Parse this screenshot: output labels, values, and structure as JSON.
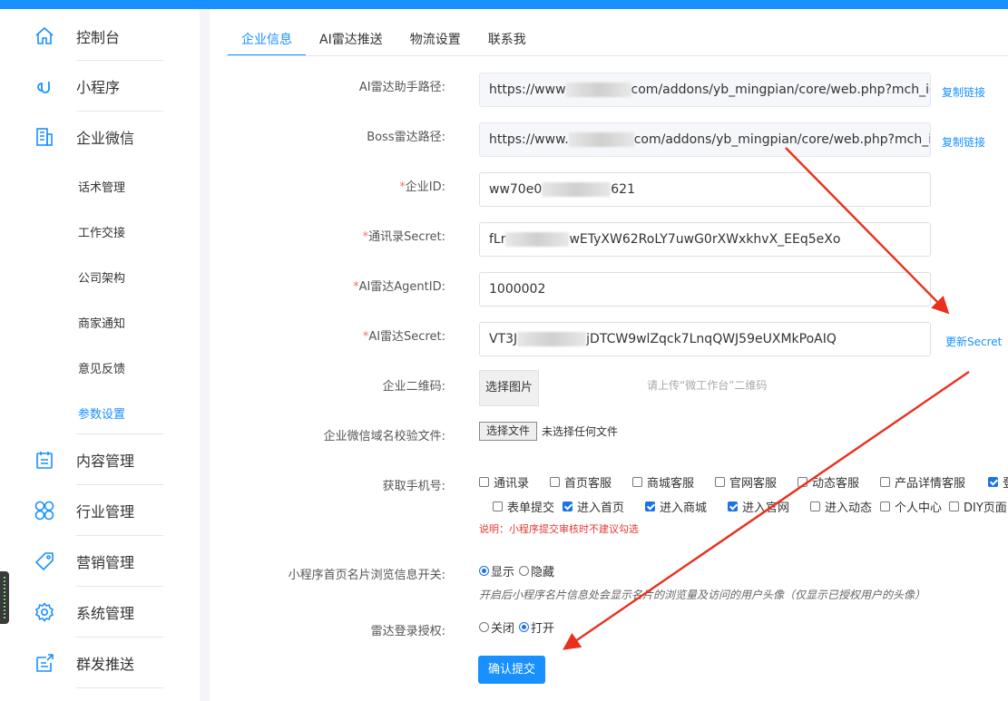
{
  "sidebar": {
    "items": [
      {
        "label": "控制台",
        "icon": "home-icon"
      },
      {
        "label": "小程序",
        "icon": "link-icon"
      },
      {
        "label": "企业微信",
        "icon": "building-icon"
      },
      {
        "label": "内容管理",
        "icon": "calendar-icon"
      },
      {
        "label": "行业管理",
        "icon": "clover-icon"
      },
      {
        "label": "营销管理",
        "icon": "tag-icon"
      },
      {
        "label": "系统管理",
        "icon": "gear-icon"
      },
      {
        "label": "群发推送",
        "icon": "broadcast-icon"
      }
    ],
    "subitems": [
      "话术管理",
      "工作交接",
      "公司架构",
      "商家通知",
      "意见反馈",
      "参数设置"
    ],
    "active_sub": "参数设置"
  },
  "tabs": [
    "企业信息",
    "AI雷达推送",
    "物流设置",
    "联系我"
  ],
  "active_tab": "企业信息",
  "form": {
    "assistant_path": {
      "label": "AI雷达助手路径:",
      "prefix": "https://www",
      "suffix": "com/addons/yb_mingpian/core/web.php?mch_id",
      "link": "复制链接"
    },
    "boss_path": {
      "label": "Boss雷达路径:",
      "prefix": "https://www.",
      "suffix": "com/addons/yb_mingpian/core/web.php?mch_id",
      "link": "复制链接"
    },
    "corp_id": {
      "label": "企业ID:",
      "prefix": "ww70e0",
      "suffix": "621"
    },
    "contact_secret": {
      "label": "通讯录Secret:",
      "prefix": "fLr",
      "suffix": "wETyXW62RoLY7uwG0rXWxkhvX_EEq5eXo"
    },
    "agent_id": {
      "label": "AI雷达AgentID:",
      "value": "1000002"
    },
    "ai_secret": {
      "label": "AI雷达Secret:",
      "prefix": "VT3J",
      "suffix": "jDTCW9wlZqck7LnqQWJ59eUXMkPoAIQ",
      "link": "更新Secret"
    },
    "qrcode": {
      "label": "企业二维码:",
      "button": "选择图片",
      "hint": "请上传“微工作台”二维码"
    },
    "domain_file": {
      "label": "企业微信域名校验文件:",
      "button": "选择文件",
      "status": "未选择任何文件"
    },
    "phone": {
      "label": "获取手机号:",
      "options_row1": [
        {
          "label": "通讯录",
          "checked": false
        },
        {
          "label": "首页客服",
          "checked": false
        },
        {
          "label": "商城客服",
          "checked": false
        },
        {
          "label": "官网客服",
          "checked": false
        },
        {
          "label": "动态客服",
          "checked": false
        },
        {
          "label": "产品详情客服",
          "checked": false
        },
        {
          "label": "登",
          "checked": true
        }
      ],
      "options_row2": [
        {
          "label": "表单提交",
          "checked": false
        },
        {
          "label": "进入首页",
          "checked": true
        },
        {
          "label": "进入商城",
          "checked": true
        },
        {
          "label": "进入官网",
          "checked": true
        },
        {
          "label": "进入动态",
          "checked": false
        },
        {
          "label": "个人中心",
          "checked": false
        },
        {
          "label": "DIY页面",
          "checked": false
        }
      ],
      "note": "说明：小程序提交审核时不建议勾选"
    },
    "card_browse": {
      "label": "小程序首页名片浏览信息开关:",
      "show": "显示",
      "hide": "隐藏",
      "selected": "显示",
      "note": "开启后小程序名片信息处会显示名片的浏览量及访问的用户头像（仅显示已授权用户的头像）"
    },
    "radar_auth": {
      "label": "雷达登录授权:",
      "off": "关闭",
      "on": "打开",
      "selected": "打开"
    },
    "submit": "确认提交"
  },
  "colors": {
    "accent": "#1890ff",
    "required": "#f56c6c",
    "annotation_arrow": "#e8301c"
  }
}
